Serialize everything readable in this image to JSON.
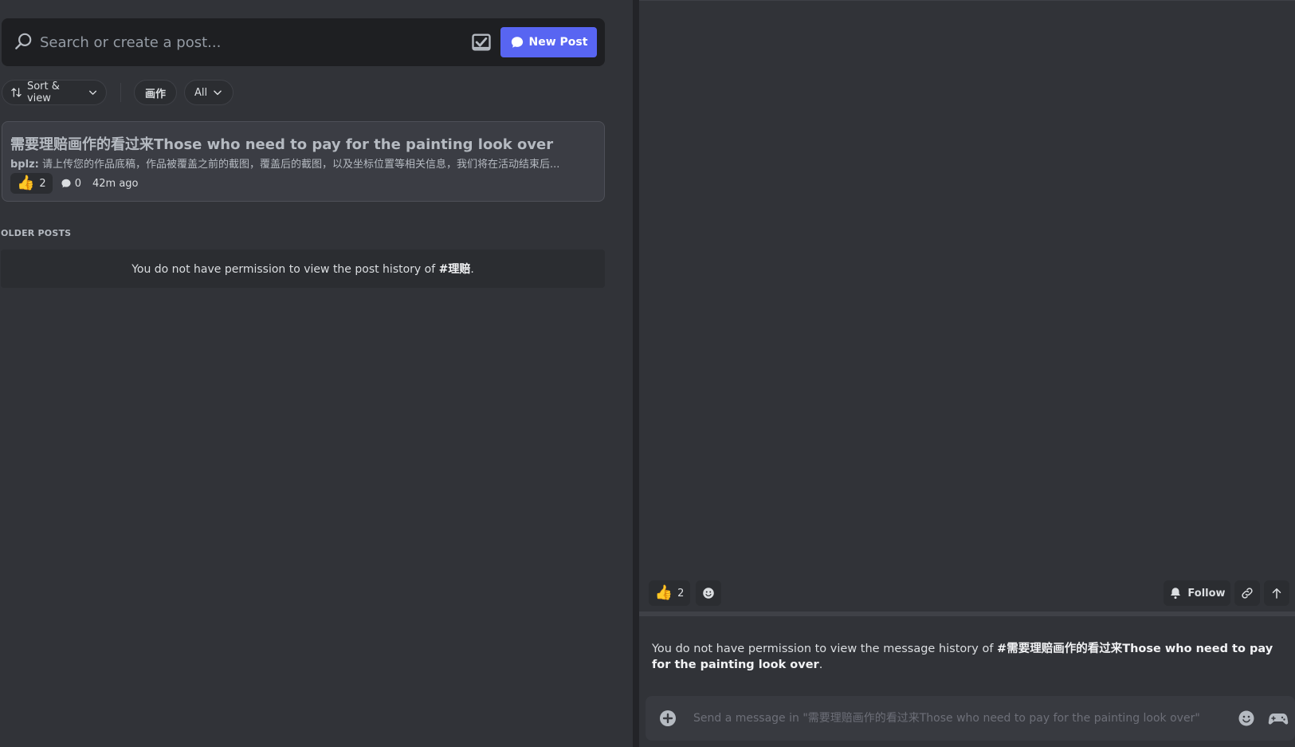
{
  "forum": {
    "search_placeholder": "Search or create a post...",
    "new_post_label": "New Post",
    "filters": {
      "sort_label": "Sort & view",
      "tag_label": "画作",
      "all_label": "All"
    },
    "post": {
      "title": "需要理赔画作的看过来Those who need to pay for the painting look over",
      "author": "bplz:",
      "preview": " 请上传您的作品底稿，作品被覆盖之前的截图，覆盖后的截图，以及坐标位置等相关信息，我们将在活动结束后...",
      "reaction_count": "2",
      "comment_count": "0",
      "time_ago": "42m ago"
    },
    "older_heading": "OLDER POSTS",
    "older_message": {
      "prefix": "You do not have permission to view the post history of ",
      "channel": "#理赔",
      "suffix": "."
    }
  },
  "thread": {
    "reaction_count": "2",
    "follow_label": "Follow",
    "message": {
      "prefix": "You do not have permission to view the message history of ",
      "channel": "#需要理赔画作的看过来Those who need to pay for the painting look over",
      "suffix": "."
    },
    "composer_placeholder": "Send a message in \"需要理赔画作的看过来Those who need to pay for the painting look over\""
  },
  "icons": {
    "search": "search-icon",
    "checklist": "checklist-icon",
    "chat": "chat-bubble-icon",
    "sort": "sort-arrows-icon",
    "chevron": "chevron-down-icon",
    "thumbs_up": "thumbs-up-emoji",
    "comment": "comment-icon",
    "add_reaction": "add-reaction-icon",
    "bell": "bell-icon",
    "link": "link-icon",
    "arrow_up": "arrow-up-icon",
    "plus": "plus-circle-icon",
    "emoji": "emoji-icon",
    "gamepad": "gamepad-icon"
  },
  "colors": {
    "background": "#313338",
    "sidebar_dark": "#1e1f22",
    "accent": "#5865f2",
    "card": "#3b3d44",
    "chip": "#2b2d31",
    "text": "#dbdee1",
    "muted": "#949ba4"
  }
}
